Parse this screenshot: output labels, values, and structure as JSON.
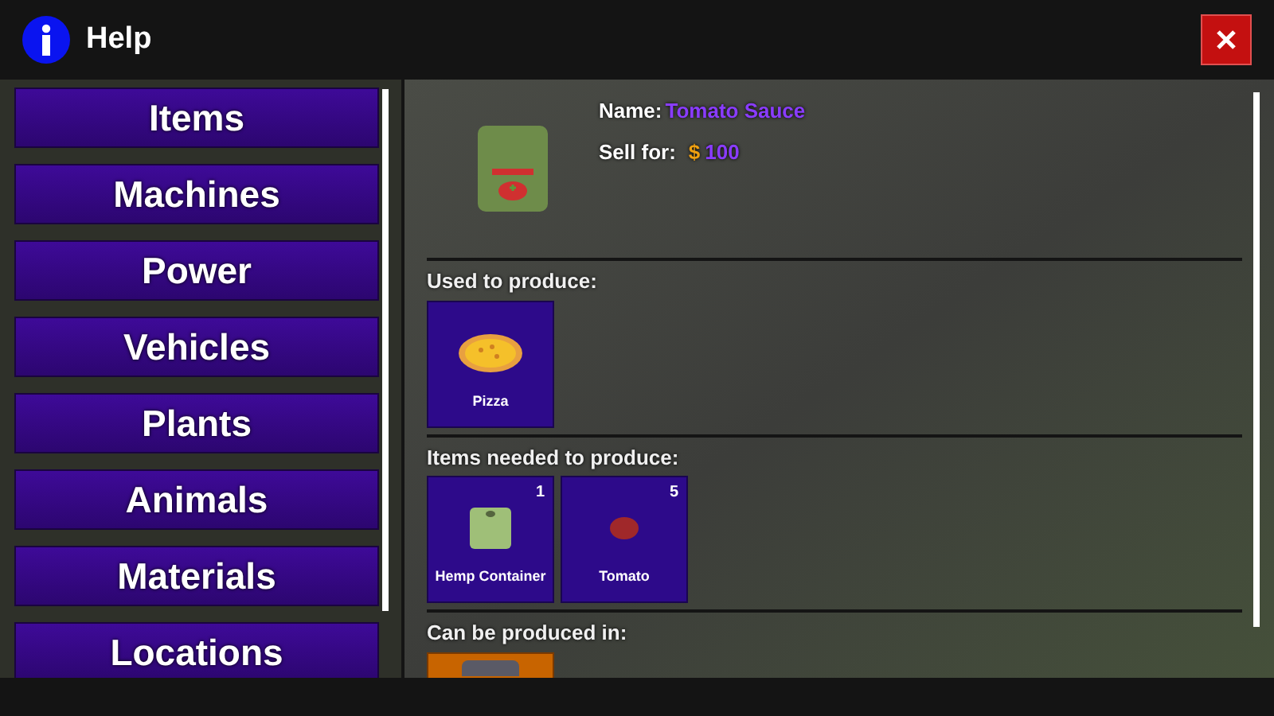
{
  "window": {
    "title": "Help"
  },
  "sidebar": {
    "items": [
      {
        "label": "Items"
      },
      {
        "label": "Machines"
      },
      {
        "label": "Power"
      },
      {
        "label": "Vehicles"
      },
      {
        "label": "Plants"
      },
      {
        "label": "Animals"
      },
      {
        "label": "Materials"
      },
      {
        "label": "Locations"
      }
    ]
  },
  "item": {
    "name_label": "Name:",
    "name": "Tomato Sauce",
    "price_label": "Sell for:",
    "currency": "$",
    "price": "100"
  },
  "sections": [
    {
      "title": "Used to produce:",
      "tiles": [
        {
          "kind": "pizza",
          "label": "Pizza"
        }
      ]
    },
    {
      "title": "Items needed to produce:",
      "tiles": [
        {
          "kind": "container",
          "label": "Hemp Container",
          "count": "1"
        },
        {
          "kind": "tomato",
          "label": "Tomato",
          "count": "5"
        }
      ]
    },
    {
      "title": "Can be produced in:",
      "tiles": [
        {
          "kind": "machine"
        }
      ]
    }
  ]
}
